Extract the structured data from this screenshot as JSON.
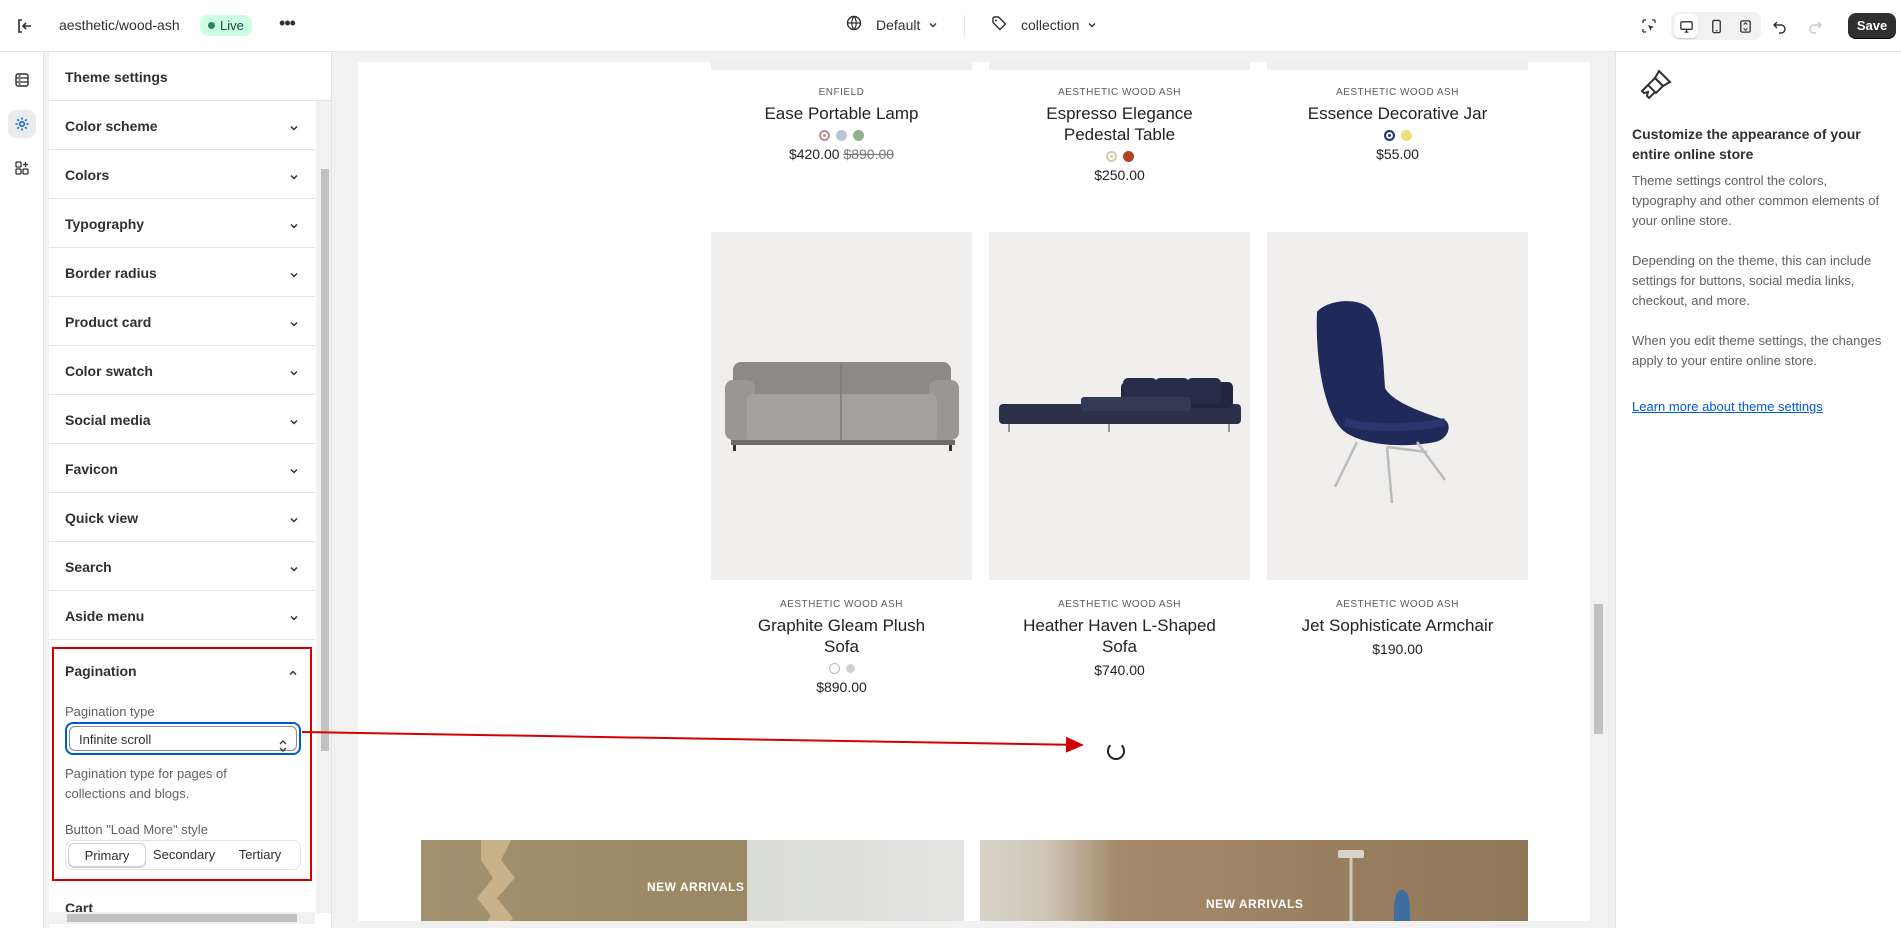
{
  "topbar": {
    "store_name": "aesthetic/wood-ash",
    "status": "Live",
    "more_label": "•••",
    "language": "Default",
    "template": "collection",
    "save_label": "Save"
  },
  "sidebar_left": {
    "title": "Theme settings",
    "sections": [
      {
        "label": "Color scheme"
      },
      {
        "label": "Colors"
      },
      {
        "label": "Typography"
      },
      {
        "label": "Border radius"
      },
      {
        "label": "Product card"
      },
      {
        "label": "Color swatch"
      },
      {
        "label": "Social media"
      },
      {
        "label": "Favicon"
      },
      {
        "label": "Quick view"
      },
      {
        "label": "Search"
      },
      {
        "label": "Aside menu"
      }
    ],
    "pagination": {
      "title": "Pagination",
      "type_label": "Pagination type",
      "type_value": "Infinite scroll",
      "help": "Pagination type for pages of collections and blogs.",
      "button_style_label": "Button \"Load More\" style",
      "button_styles": [
        "Primary",
        "Secondary",
        "Tertiary"
      ],
      "selected_style": "Primary"
    },
    "next_section": "Cart"
  },
  "preview": {
    "top_products": [
      {
        "vendor": "ENFIELD",
        "title": "Ease Portable Lamp",
        "price": "$420.00",
        "compare_price": "$890.00",
        "swatches": [
          "#c48b8b",
          "#b9c5d4",
          "#8fb08a"
        ]
      },
      {
        "vendor": "AESTHETIC WOOD ASH",
        "title": "Espresso Elegance Pedestal Table",
        "price": "$250.00",
        "swatches": [
          "#d9c9a8",
          "#b6401f"
        ]
      },
      {
        "vendor": "AESTHETIC WOOD ASH",
        "title": "Essence Decorative Jar",
        "price": "$55.00",
        "swatches": [
          "#27366e",
          "#efe07a"
        ]
      }
    ],
    "products": [
      {
        "vendor": "AESTHETIC WOOD ASH",
        "title": "Graphite Gleam Plush Sofa",
        "price": "$890.00",
        "swatches": [
          "#ffffff",
          "#d0d0d0"
        ]
      },
      {
        "vendor": "AESTHETIC WOOD ASH",
        "title": "Heather Haven L-Shaped Sofa",
        "price": "$740.00",
        "swatches": []
      },
      {
        "vendor": "AESTHETIC WOOD ASH",
        "title": "Jet Sophisticate Armchair",
        "price": "$190.00",
        "swatches": []
      }
    ],
    "banners": [
      {
        "label": "NEW ARRIVALS"
      },
      {
        "label": "NEW ARRIVALS"
      }
    ]
  },
  "sidebar_right": {
    "title": "Customize the appearance of your entire online store",
    "paragraphs": [
      "Theme settings control the colors, typography and other common elements of your online store.",
      "Depending on the theme, this can include settings for buttons, social media links, checkout, and more.",
      "When you edit theme settings, the changes apply to your entire online store."
    ],
    "link": "Learn more about theme settings"
  },
  "colors": {
    "annotation": "#d40000",
    "focus": "#005bd3",
    "save_bg": "#303030",
    "live_bg": "#cdfee1"
  }
}
